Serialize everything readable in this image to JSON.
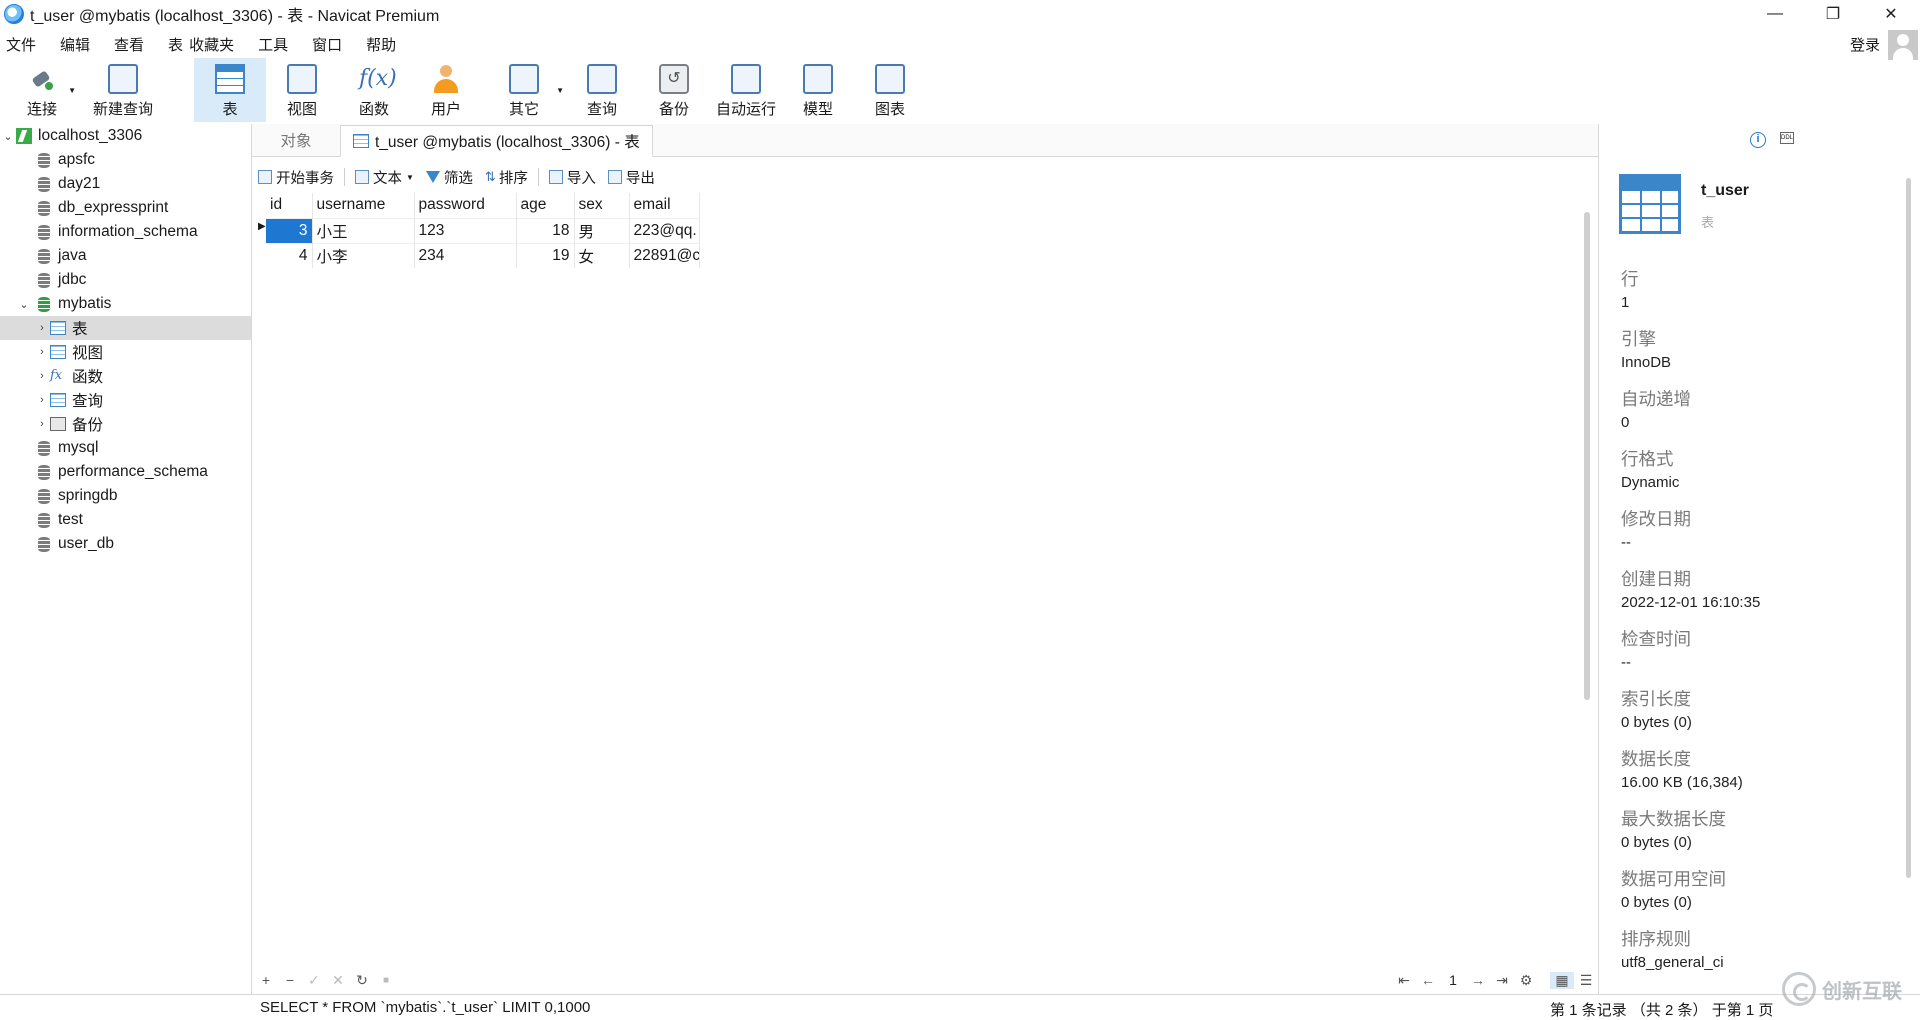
{
  "window": {
    "title": "t_user @mybatis (localhost_3306) - 表 - Navicat Premium",
    "minimize": "—",
    "maximize": "❐",
    "close": "✕"
  },
  "menu": {
    "items": [
      "文件",
      "编辑",
      "查看",
      "表",
      "收藏夹",
      "工具",
      "窗口",
      "帮助"
    ],
    "login": "登录"
  },
  "toolbar": {
    "buttons": [
      {
        "label": "连接",
        "icon": "plug-icon"
      },
      {
        "label": "新建查询",
        "icon": "new-query-icon"
      },
      {
        "label": "表",
        "icon": "table-icon",
        "active": true
      },
      {
        "label": "视图",
        "icon": "view-icon"
      },
      {
        "label": "函数",
        "icon": "function-icon",
        "glyph": "f(x)"
      },
      {
        "label": "用户",
        "icon": "user-icon"
      },
      {
        "label": "其它",
        "icon": "tools-icon"
      },
      {
        "label": "查询",
        "icon": "query-icon"
      },
      {
        "label": "备份",
        "icon": "backup-icon",
        "glyph": "↺"
      },
      {
        "label": "自动运行",
        "icon": "schedule-icon"
      },
      {
        "label": "模型",
        "icon": "model-icon"
      },
      {
        "label": "图表",
        "icon": "chart-icon"
      }
    ]
  },
  "navigator": {
    "connection": "localhost_3306",
    "databases": [
      "apsfc",
      "day21",
      "db_expressprint",
      "information_schema",
      "java",
      "jdbc",
      "mybatis"
    ],
    "mybatis_children": [
      "表",
      "视图",
      "函数",
      "查询",
      "备份"
    ],
    "databases_after": [
      "mysql",
      "performance_schema",
      "springdb",
      "test",
      "user_db"
    ]
  },
  "tabs": {
    "objects": "对象",
    "active": "t_user @mybatis (localhost_3306) - 表"
  },
  "subtoolbar": {
    "begin_transaction": "开始事务",
    "text": "文本",
    "filter": "筛选",
    "sort": "排序",
    "import": "导入",
    "export": "导出"
  },
  "grid": {
    "columns": [
      "id",
      "username",
      "password",
      "age",
      "sex",
      "email"
    ],
    "rows": [
      [
        "3",
        "小王",
        "123",
        "18",
        "男",
        "223@qq."
      ],
      [
        "4",
        "小李",
        "234",
        "19",
        "女",
        "22891@c"
      ]
    ]
  },
  "gridbar": {
    "add": "+",
    "remove": "−",
    "apply": "✓",
    "cancel": "✕",
    "refresh": "↻",
    "stop": "■",
    "first": "⇤",
    "prev": "←",
    "page": "1",
    "next": "→",
    "last": "⇥",
    "settings": "⚙"
  },
  "info": {
    "name": "t_user",
    "type": "表",
    "properties": [
      {
        "label": "行",
        "value": "1"
      },
      {
        "label": "引擎",
        "value": "InnoDB"
      },
      {
        "label": "自动递增",
        "value": "0"
      },
      {
        "label": "行格式",
        "value": "Dynamic"
      },
      {
        "label": "修改日期",
        "value": "--"
      },
      {
        "label": "创建日期",
        "value": "2022-12-01 16:10:35"
      },
      {
        "label": "检查时间",
        "value": "--"
      },
      {
        "label": "索引长度",
        "value": "0 bytes (0)"
      },
      {
        "label": "数据长度",
        "value": "16.00 KB (16,384)"
      },
      {
        "label": "最大数据长度",
        "value": "0 bytes (0)"
      },
      {
        "label": "数据可用空间",
        "value": "0 bytes (0)"
      },
      {
        "label": "排序规则",
        "value": "utf8_general_ci"
      }
    ]
  },
  "status": {
    "sql": "SELECT * FROM `mybatis`.`t_user` LIMIT 0,1000",
    "records": "第 1 条记录 （共 2 条） 于第 1 页"
  },
  "watermark": "创新互联"
}
